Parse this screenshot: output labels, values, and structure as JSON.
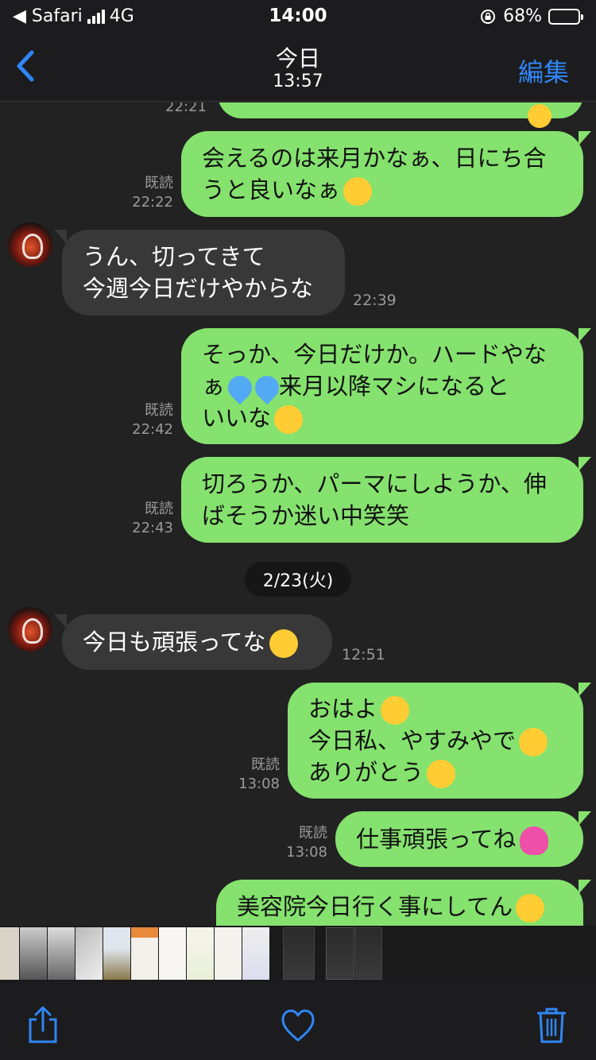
{
  "status_bar": {
    "back_app": "◀ Safari",
    "network": "4G",
    "time": "14:00",
    "battery": "68%"
  },
  "header": {
    "title": "今日",
    "subtitle": "13:57",
    "edit_label": "編集"
  },
  "messages": [
    {
      "side": "out",
      "read": "",
      "time": "22:21",
      "text": ""
    },
    {
      "side": "out",
      "read": "既読",
      "time": "22:22",
      "text": "会えるのは来月かなぁ、日にち合\nうと良いなぁ",
      "emoji": "flushed-emoji"
    },
    {
      "side": "in",
      "time": "22:39",
      "text": "うん、切ってきて\n今週今日だけやからな"
    },
    {
      "side": "out",
      "read": "既読",
      "time": "22:42",
      "text_1": "そっか、今日だけか。ハードやな\nぁ",
      "text_2": "来月以降マシになると\nいいな",
      "emojis": [
        "sweat-droplets-emoji",
        "sweat-droplets-emoji",
        "screaming-face-emoji"
      ]
    },
    {
      "side": "out",
      "read": "既読",
      "time": "22:43",
      "text": "切ろうか、パーマにしようか、伸\nばそうか迷い中笑笑"
    },
    {
      "side": "in",
      "time": "12:51",
      "text": "今日も頑張ってな",
      "emoji": "smiley-emoji"
    },
    {
      "side": "out",
      "read": "既読",
      "time": "13:08",
      "lines": [
        "おはよ",
        "今日私、やすみやで",
        "ありがとう"
      ],
      "emojis": [
        "blush-emoji",
        "blush-emoji",
        "laughing-emoji"
      ]
    },
    {
      "side": "out",
      "read": "既読",
      "time": "13:08",
      "text": "仕事頑張ってね",
      "emoji": "sparkling-heart-emoji"
    },
    {
      "side": "out",
      "read": "",
      "time": "",
      "text": "美容院今日行く事にしてん",
      "emoji": "laughing-emoji"
    }
  ],
  "date_separator": "2/23(火)",
  "colors": {
    "outgoing_bubble": "#85e26e",
    "incoming_bubble": "#383838",
    "background": "#222222",
    "accent": "#2f86f6"
  },
  "toolbar": {
    "share": "share-icon",
    "favorite": "heart-icon",
    "delete": "trash-icon"
  }
}
